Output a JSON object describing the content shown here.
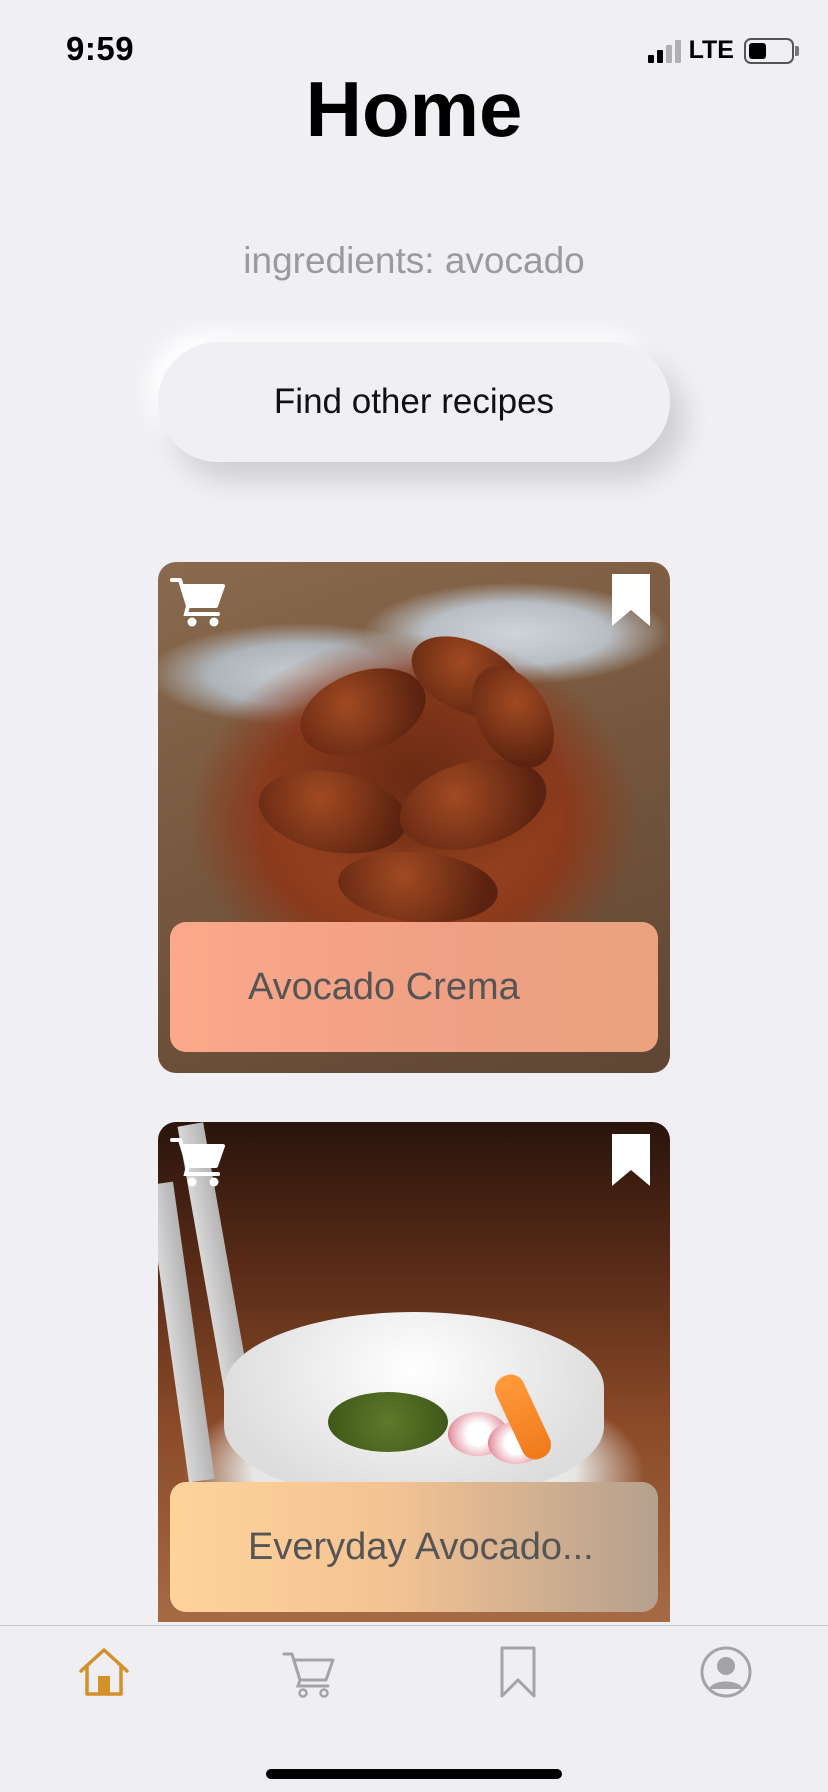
{
  "status_bar": {
    "time": "9:59",
    "network": "LTE"
  },
  "header": {
    "title": "Home",
    "subtitle": "ingredients: avocado"
  },
  "actions": {
    "find_label": "Find other recipes"
  },
  "recipes": [
    {
      "name": "Avocado Crema",
      "photo": "chicken wings in a copper pan",
      "label_colors": [
        "#fba88b",
        "#eaa27f"
      ]
    },
    {
      "name": "Everyday Avocado...",
      "photo": "grain bowl with radish and greens",
      "label_colors": [
        "#ffd39a",
        "#b5a08e"
      ]
    }
  ],
  "tab_bar": {
    "items": [
      {
        "icon": "home-icon",
        "active": true
      },
      {
        "icon": "cart-icon",
        "active": false
      },
      {
        "icon": "bookmark-icon",
        "active": false
      },
      {
        "icon": "profile-icon",
        "active": false
      }
    ],
    "active_color": "#d4912a",
    "inactive_color": "#a3a3a8"
  }
}
